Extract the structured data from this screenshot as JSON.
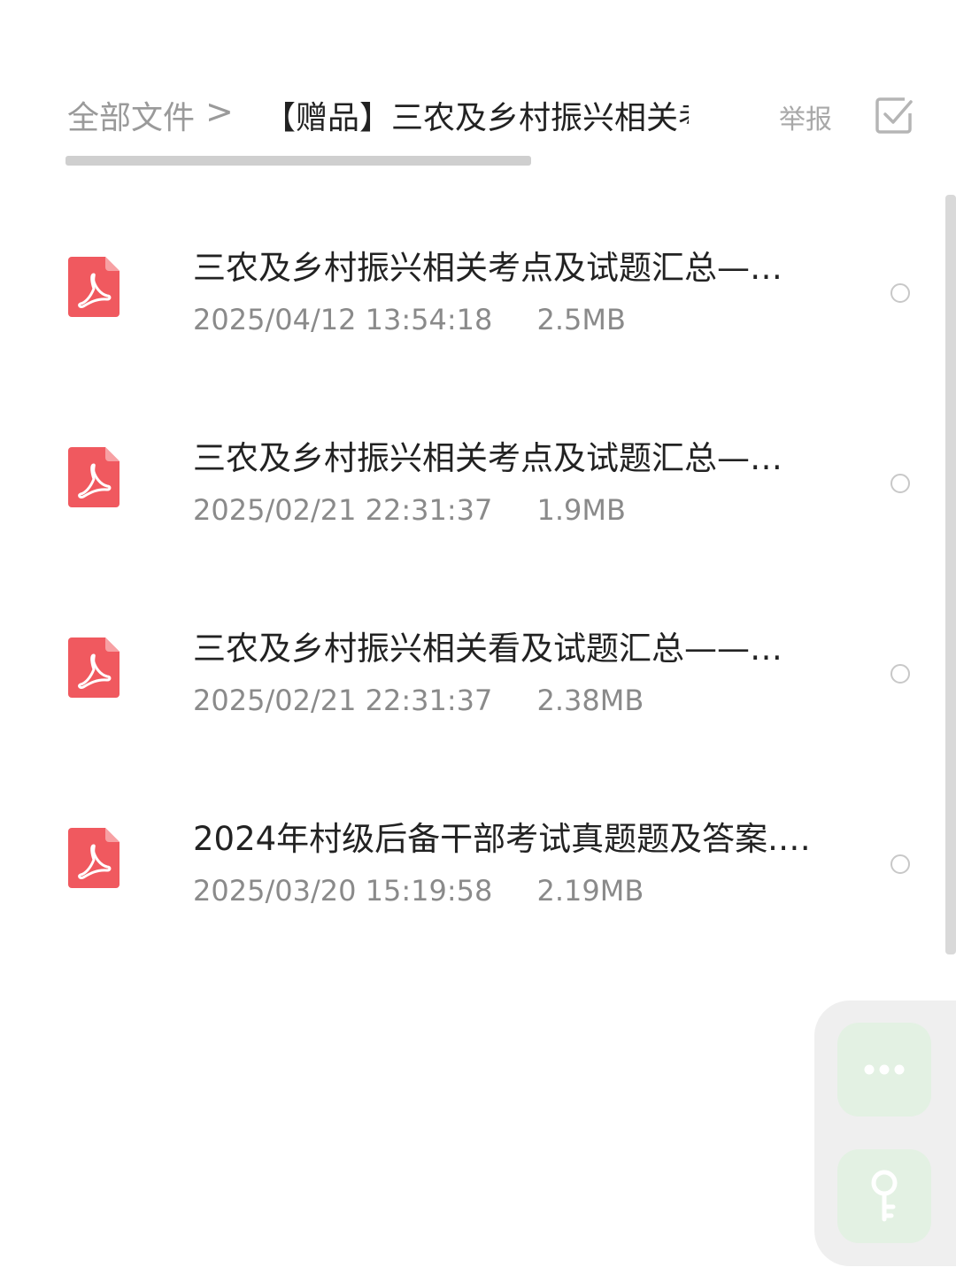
{
  "breadcrumb": {
    "root": "全部文件",
    "separator": ">",
    "current": "【赠品】三农及乡村振兴相关考"
  },
  "header": {
    "report_label": "举报",
    "select_icon": "checkbox-select-icon"
  },
  "files": [
    {
      "name": "三农及乡村振兴相关考点及试题汇总—…",
      "date": "2025/04/12",
      "time": "13:54:18",
      "size": "2.5MB",
      "icon": "pdf-icon"
    },
    {
      "name": "三农及乡村振兴相关考点及试题汇总—…",
      "date": "2025/02/21",
      "time": "22:31:37",
      "size": "1.9MB",
      "icon": "pdf-icon"
    },
    {
      "name": "三农及乡村振兴相关看及试题汇总——…",
      "date": "2025/02/21",
      "time": "22:31:37",
      "size": "2.38MB",
      "icon": "pdf-icon"
    },
    {
      "name": "2024年村级后备干部考试真题题及答案.…",
      "date": "2025/03/20",
      "time": "15:19:58",
      "size": "2.19MB",
      "icon": "pdf-icon"
    }
  ],
  "fab": {
    "more_icon": "more-dots-icon",
    "key_icon": "key-icon"
  },
  "colors": {
    "pdf_red": "#f0595f",
    "fab_green": "#e3f1e3",
    "fab_icon": "#bfe3bf"
  }
}
